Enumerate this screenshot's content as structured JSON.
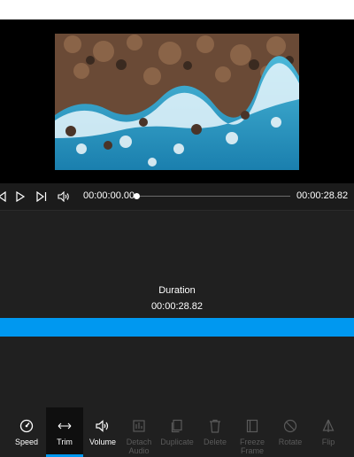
{
  "transport": {
    "current_time": "00:00:00.00",
    "total_time": "00:00:28.82",
    "progress": 0
  },
  "duration": {
    "label": "Duration",
    "value": "00:00:28.82"
  },
  "toolbar": {
    "speed": "Speed",
    "trim": "Trim",
    "volume": "Volume",
    "detach_audio": [
      "Detach",
      "Audio"
    ],
    "duplicate": "Duplicate",
    "delete": "Delete",
    "freeze_frame": [
      "Freeze",
      "Frame"
    ],
    "rotate": "Rotate",
    "flip": "Flip"
  },
  "colors": {
    "accent": "#0098f0",
    "disabled": "#5a5a5a"
  }
}
